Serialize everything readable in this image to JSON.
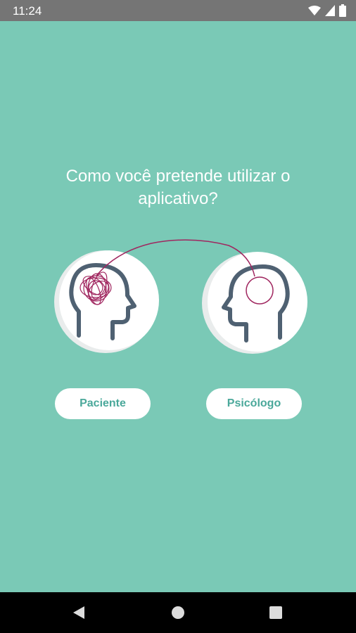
{
  "status_bar": {
    "time": "11:24",
    "icons": [
      "wifi-icon",
      "signal-icon",
      "battery-icon"
    ]
  },
  "onboarding": {
    "question_line1": "Como você pretende utilizar o",
    "question_line2": "aplicativo?",
    "options": [
      {
        "label": "Paciente",
        "icon": "confused-head-icon"
      },
      {
        "label": "Psicólogo",
        "icon": "calm-head-icon"
      }
    ]
  },
  "nav_bar": {
    "icons": [
      "back-icon",
      "home-icon",
      "recent-apps-icon"
    ]
  },
  "colors": {
    "background": "#7ac9b6",
    "button_text": "#4aa89a",
    "head_outline": "#4f6172",
    "scribble": "#a0265f"
  }
}
